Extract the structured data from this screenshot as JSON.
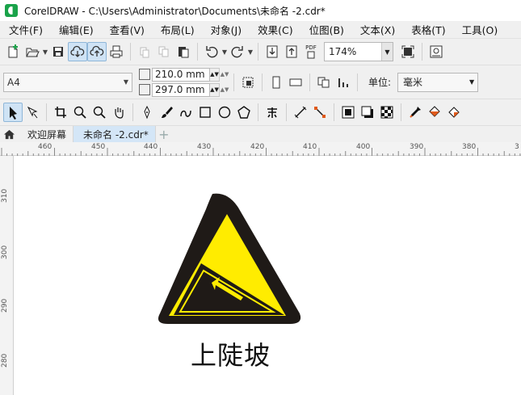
{
  "window": {
    "title": "CorelDRAW - C:\\Users\\Administrator\\Documents\\未命名 -2.cdr*"
  },
  "menu": [
    "文件(F)",
    "编辑(E)",
    "查看(V)",
    "布局(L)",
    "对象(J)",
    "效果(C)",
    "位图(B)",
    "文本(X)",
    "表格(T)",
    "工具(O)"
  ],
  "toolbar": {
    "zoom_value": "174%",
    "pdf_label": "PDF"
  },
  "property_bar": {
    "page_size": "A4",
    "width": "210.0 mm",
    "height": "297.0 mm",
    "unit_label": "单位:",
    "unit_value": "毫米"
  },
  "tabs": {
    "welcome": "欢迎屏幕",
    "document": "未命名 -2.cdr*",
    "add": "+"
  },
  "ruler": {
    "h_labels": [
      "460",
      "450",
      "440",
      "430",
      "420",
      "410",
      "400",
      "390",
      "380",
      "3"
    ],
    "v_labels": [
      "310",
      "300",
      "290",
      "280"
    ]
  },
  "sign": {
    "caption": "上陡坡",
    "colors": {
      "yellow": "#ffec00",
      "black": "#1f1a17"
    }
  }
}
